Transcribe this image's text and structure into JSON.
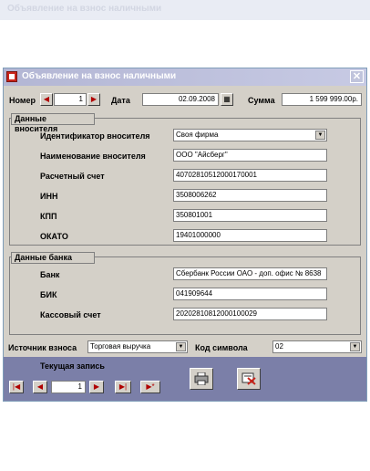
{
  "background_title": "Объявление на взнос наличными",
  "window": {
    "title": "Объявление на взнос наличными",
    "close": "✕"
  },
  "header": {
    "number_label": "Номер",
    "number_value": "1",
    "date_label": "Дата",
    "date_value": "02.09.2008",
    "sum_label": "Сумма",
    "sum_value": "1 599 999.00р."
  },
  "depositor": {
    "section_title": "Данные вносителя",
    "id_label": "Идентификатор вносителя",
    "id_value": "Своя фирма",
    "name_label": "Наименование вносителя",
    "name_value": "ООО \"Айсберг\"",
    "account_label": "Расчетный счет",
    "account_value": "40702810512000170001",
    "inn_label": "ИНН",
    "inn_value": "3508006262",
    "kpp_label": "КПП",
    "kpp_value": "350801001",
    "okato_label": "ОКАТО",
    "okato_value": "19401000000"
  },
  "bank": {
    "section_title": "Данные банка",
    "bank_label": "Банк",
    "bank_value": "Сбербанк России ОАО - доп. офис № 8638",
    "bik_label": "БИК",
    "bik_value": "041909644",
    "cash_label": "Кассовый счет",
    "cash_value": "20202810812000100029"
  },
  "footer": {
    "source_label": "Источник взноса",
    "source_value": "Торговая выручка",
    "code_label": "Код символа",
    "code_value": "02"
  },
  "navigator": {
    "current_label": "Текущая запись",
    "current_value": "1"
  },
  "icons": {
    "close": "close-icon",
    "print": "printer-icon",
    "delete": "delete-record-icon"
  },
  "colors": {
    "nav_bar": "#7b7fa8",
    "window_bg": "#d4d0c8",
    "icon_red": "#c8241b"
  }
}
